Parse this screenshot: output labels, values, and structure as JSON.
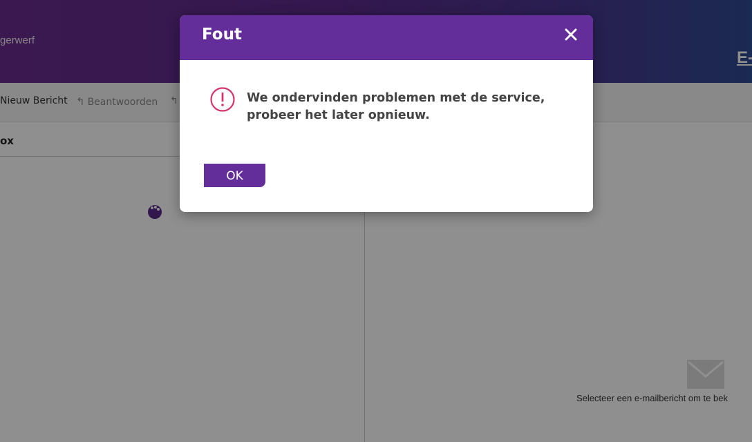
{
  "app": {
    "user_name_fragment": "gerwerf",
    "brand_fragment": "E-"
  },
  "toolbar": {
    "new_message_label": "Nieuw Bericht",
    "reply_label": "Beantwoorden",
    "reply_icon": "reply-icon"
  },
  "list": {
    "folder_title": "ox"
  },
  "reading_pane": {
    "empty_hint": "Selecteer een e-mailbericht om te bek",
    "icon": "envelope-icon"
  },
  "dialog": {
    "title": "Fout",
    "close_icon": "close-icon",
    "error_icon": "exclamation-circle-icon",
    "message": "We ondervinden problemen met de service, probeer het later opnieuw.",
    "ok_label": "OK"
  },
  "colors": {
    "brand_purple": "#632e9a",
    "error_red": "#d6336c",
    "overlay": "rgba(0,0,0,0.44)"
  }
}
